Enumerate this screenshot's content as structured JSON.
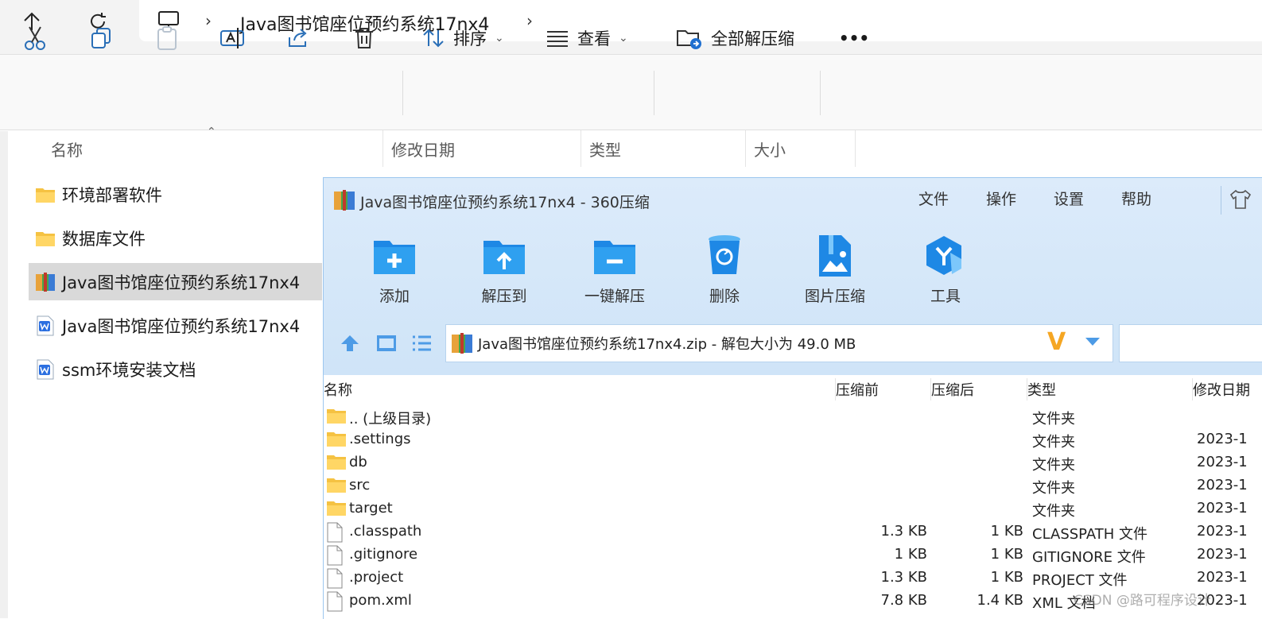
{
  "address_bar": {
    "breadcrumb": "Java图书馆座位预约系统17nx4",
    "up_icon": "arrow-up-icon",
    "refresh_icon": "refresh-icon",
    "pc_icon": "monitor-icon"
  },
  "command_bar": {
    "sort_label": "排序",
    "view_label": "查看",
    "extract_all_label": "全部解压缩",
    "more_label": "•••"
  },
  "columns": {
    "name": "名称",
    "date": "修改日期",
    "type": "类型",
    "size": "大小"
  },
  "explorer_files": [
    {
      "name": "环境部署软件",
      "icon": "folder-icon"
    },
    {
      "name": "数据库文件",
      "icon": "folder-icon"
    },
    {
      "name": "Java图书馆座位预约系统17nx4",
      "icon": "zip-archive-icon",
      "selected": true
    },
    {
      "name": "Java图书馆座位预约系统17nx4",
      "icon": "word-doc-icon"
    },
    {
      "name": "ssm环境安装文档",
      "icon": "word-doc-icon"
    }
  ],
  "zip_window": {
    "title": "Java图书馆座位预约系统17nx4 - 360压缩",
    "menu": [
      "文件",
      "操作",
      "设置",
      "帮助"
    ],
    "tools": [
      "添加",
      "解压到",
      "一键解压",
      "删除",
      "图片压缩",
      "工具"
    ],
    "path": "Java图书馆座位预约系统17nx4.zip - 解包大小为 49.0 MB",
    "headers": {
      "name": "名称",
      "before": "压缩前",
      "after": "压缩后",
      "type": "类型",
      "date": "修改日期"
    },
    "rows": [
      {
        "name": ".. (上级目录)",
        "before": "",
        "after": "",
        "type": "文件夹",
        "date": "",
        "icon": "folder-icon"
      },
      {
        "name": ".settings",
        "before": "",
        "after": "",
        "type": "文件夹",
        "date": "2023-1",
        "icon": "folder-icon"
      },
      {
        "name": "db",
        "before": "",
        "after": "",
        "type": "文件夹",
        "date": "2023-1",
        "icon": "folder-icon"
      },
      {
        "name": "src",
        "before": "",
        "after": "",
        "type": "文件夹",
        "date": "2023-1",
        "icon": "folder-icon"
      },
      {
        "name": "target",
        "before": "",
        "after": "",
        "type": "文件夹",
        "date": "2023-1",
        "icon": "folder-icon"
      },
      {
        "name": ".classpath",
        "before": "1.3 KB",
        "after": "1 KB",
        "type": "CLASSPATH 文件",
        "date": "2023-1",
        "icon": "file-icon"
      },
      {
        "name": ".gitignore",
        "before": "1 KB",
        "after": "1 KB",
        "type": "GITIGNORE 文件",
        "date": "2023-1",
        "icon": "file-icon"
      },
      {
        "name": ".project",
        "before": "1.3 KB",
        "after": "1 KB",
        "type": "PROJECT 文件",
        "date": "2023-1",
        "icon": "file-icon"
      },
      {
        "name": "pom.xml",
        "before": "7.8 KB",
        "after": "1.4 KB",
        "type": "XML 文档",
        "date": "2023-1",
        "icon": "file-icon"
      }
    ]
  },
  "watermark": "CSDN @路可程序设计",
  "colors": {
    "accent": "#1e90e8",
    "selected_row": "#d9d9d9",
    "zip_header": "#d3e6f9",
    "folder": "#f5c242"
  }
}
